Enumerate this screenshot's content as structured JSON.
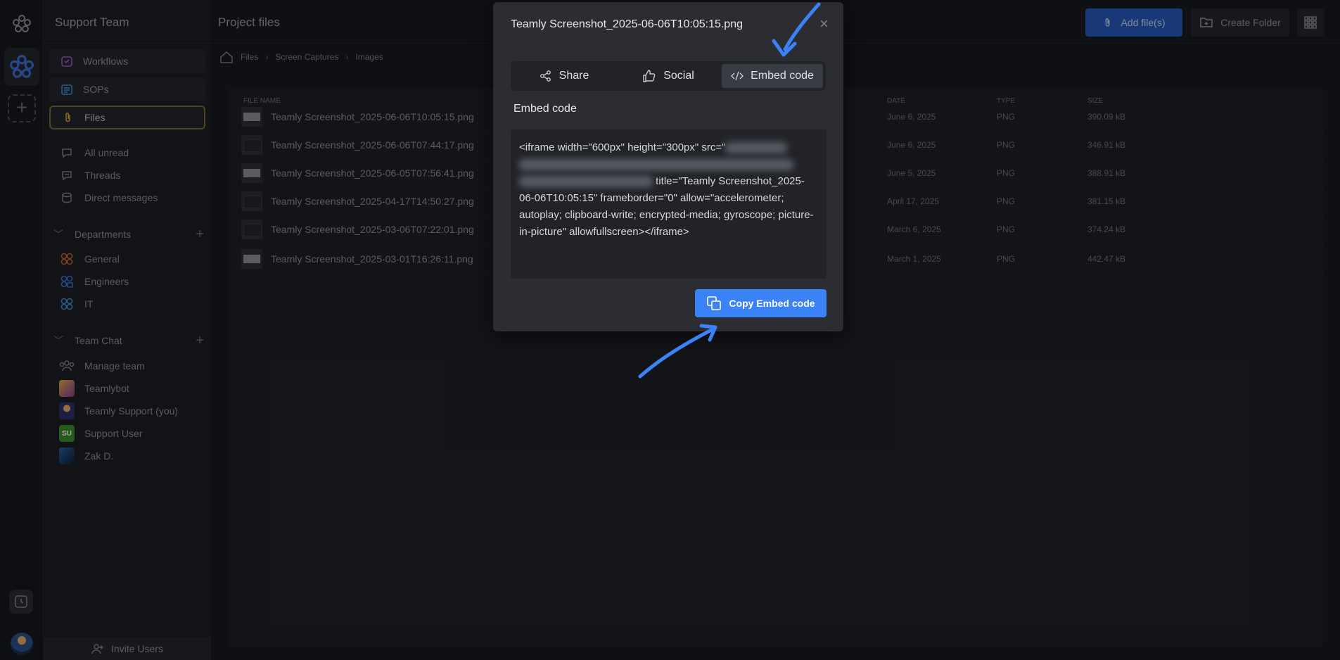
{
  "workspace": {
    "name": "Support Team"
  },
  "sidebar": {
    "items": [
      {
        "label": "Workflows",
        "icon": "workflows-icon"
      },
      {
        "label": "SOPs",
        "icon": "sops-icon"
      },
      {
        "label": "Files",
        "icon": "paperclip-icon"
      }
    ],
    "nav": [
      {
        "label": "All unread",
        "icon": "chat-bubble-icon"
      },
      {
        "label": "Threads",
        "icon": "threads-icon"
      },
      {
        "label": "Direct messages",
        "icon": "database-icon"
      }
    ],
    "departments_label": "Departments",
    "departments": [
      {
        "label": "General",
        "color": "#c8622f"
      },
      {
        "label": "Engineers",
        "color": "#3b6fd4"
      },
      {
        "label": "IT",
        "color": "#3a8fd9"
      }
    ],
    "team_chat_label": "Team Chat",
    "team_chat": [
      {
        "label": "Manage team",
        "avatar": ""
      },
      {
        "label": "Teamlybot",
        "avatar": ""
      },
      {
        "label": "Teamly Support (you)",
        "avatar": ""
      },
      {
        "label": "Support User",
        "avatar": "SU"
      },
      {
        "label": "Zak D.",
        "avatar": ""
      }
    ],
    "invite_label": "Invite Users"
  },
  "header": {
    "title": "Project files",
    "add_files_label": "Add file(s)",
    "create_folder_label": "Create Folder"
  },
  "breadcrumb": [
    "Files",
    "Screen Captures",
    "Images"
  ],
  "table": {
    "columns": {
      "name": "FILE NAME",
      "date": "DATE",
      "type": "TYPE",
      "size": "SIZE"
    },
    "rows": [
      {
        "name": "Teamly Screenshot_2025-06-06T10:05:15.png",
        "date": "June 6, 2025",
        "type": "PNG",
        "size": "390.09 kB",
        "thumb": "light"
      },
      {
        "name": "Teamly Screenshot_2025-06-06T07:44:17.png",
        "date": "June 6, 2025",
        "type": "PNG",
        "size": "346.91 kB",
        "thumb": "dark"
      },
      {
        "name": "Teamly Screenshot_2025-06-05T07:56:41.png",
        "date": "June 5, 2025",
        "type": "PNG",
        "size": "388.91 kB",
        "thumb": "light"
      },
      {
        "name": "Teamly Screenshot_2025-04-17T14:50:27.png",
        "date": "April 17, 2025",
        "type": "PNG",
        "size": "381.15 kB",
        "thumb": "dark"
      },
      {
        "name": "Teamly Screenshot_2025-03-06T07:22:01.png",
        "date": "March 6, 2025",
        "type": "PNG",
        "size": "374.24 kB",
        "thumb": "dark"
      },
      {
        "name": "Teamly Screenshot_2025-03-01T16:26:11.png",
        "date": "March 1, 2025",
        "type": "PNG",
        "size": "442.47 kB",
        "thumb": "light"
      }
    ]
  },
  "modal": {
    "title": "Teamly Screenshot_2025-06-06T10:05:15.png",
    "tabs": [
      {
        "label": "Share",
        "icon": "share-icon"
      },
      {
        "label": "Social",
        "icon": "thumbs-up-icon"
      },
      {
        "label": "Embed code",
        "icon": "code-icon"
      }
    ],
    "active_tab": "Embed code",
    "section_label": "Embed code",
    "code_start": "<iframe width=\"600px\" height=\"300px\" src=\"",
    "code_end": "title=\"Teamly Screenshot_2025-06-06T10:05:15\" frameborder=\"0\" allow=\"accelerometer; autoplay; clipboard-write; encrypted-media; gyroscope; picture-in-picture\" allowfullscreen></iframe>",
    "copy_label": "Copy Embed code"
  },
  "colors": {
    "accent": "#3b82f6",
    "arrow": "#3b82f6"
  }
}
